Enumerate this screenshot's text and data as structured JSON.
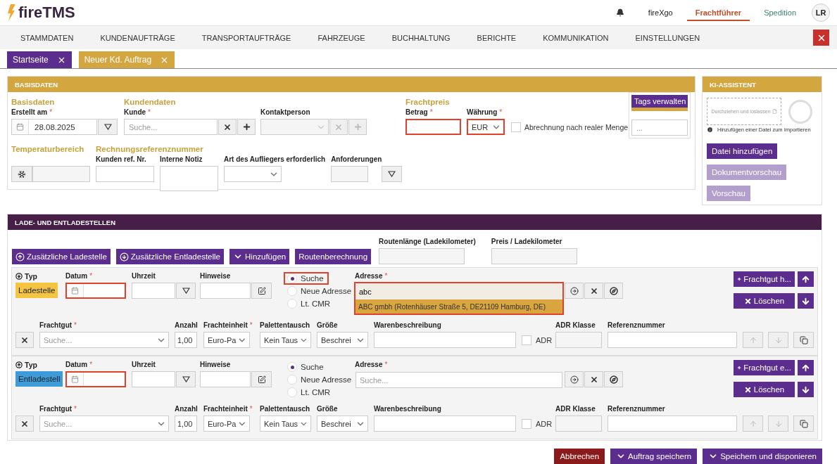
{
  "header": {
    "logo": "fireTMS",
    "links": [
      {
        "label": "fireXgo",
        "selected": false,
        "color": "#222222"
      },
      {
        "label": "Frachtführer",
        "selected": true,
        "color": "#c0502a"
      },
      {
        "label": "Spedition",
        "selected": false,
        "color": "#3d7f6f"
      }
    ],
    "avatar": "LR"
  },
  "menu": [
    "STAMMDATEN",
    "KUNDENAUFTRÄGE",
    "TRANSPORTAUFTRÄGE",
    "FAHRZEUGE",
    "BUCHHALTUNG",
    "BERICHTE",
    "KOMMUNIKATION",
    "EINSTELLUNGEN"
  ],
  "tabs": [
    {
      "label": "Startseite",
      "selected": false
    },
    {
      "label": "Neuer Kd. Auftrag",
      "selected": true
    }
  ],
  "basisdaten": {
    "title": "BASISDATEN",
    "basis": {
      "heading": "Basisdaten",
      "label": "Erstellt am",
      "required_mark": "*",
      "value": "28.08.2025"
    },
    "kunde": {
      "heading": "Kundendaten",
      "label": "Kunde",
      "required_mark": "*",
      "placeholder": "Suche..."
    },
    "kontakt": {
      "label": "Kontaktperson",
      "disabled": true
    },
    "frachtpreis": {
      "heading": "Frachtpreis",
      "betrag": {
        "label": "Betrag",
        "required_mark": "*",
        "error": true
      },
      "waehrung": {
        "label": "Währung",
        "required_mark": "*",
        "value": "EUR",
        "error": true
      },
      "abrechnung": {
        "label": "Abrechnung nach realer Menge",
        "checked": false
      }
    },
    "tags": {
      "button": "Tags verwalten",
      "placeholder": "..."
    },
    "temperatur": {
      "heading": "Temperaturbereich"
    },
    "rechnung": {
      "heading": "Rechnungsreferenznummer",
      "kunden_ref": "Kunden ref. Nr.",
      "notiz": "Interne Notiz"
    },
    "auflieger": {
      "label": "Art des Aufliegers erforderlich"
    },
    "anforderungen": {
      "label": "Anforderungen"
    }
  },
  "ki": {
    "title": "KI-ASSISTENT",
    "dropzone": "Durchziehen und loslassen",
    "hint": "Hinzufügen einer Datei zum Importieren",
    "buttons": [
      {
        "label": "Datei hinzufügen",
        "disabled": false
      },
      {
        "label": "Dokumentvorschau",
        "disabled": true
      },
      {
        "label": "Vorschau",
        "disabled": true
      }
    ]
  },
  "stellen": {
    "title": "LADE- UND ENTLADESTELLEN",
    "actions": [
      {
        "kind": "load",
        "label": "Zusätzliche Ladestelle"
      },
      {
        "kind": "unload",
        "label": "Zusätzliche Entladestelle"
      },
      {
        "kind": "dropdown",
        "label": "Hinzufügen"
      },
      {
        "kind": "plain",
        "label": "Routenberechnung"
      }
    ],
    "route_fields": [
      "Routenlänge (Ladekilometer)",
      "Preis / Ladekilometer"
    ],
    "stops": [
      {
        "kind": "load",
        "typ": "Typ",
        "type": "Ladestelle",
        "color": "#f5c542",
        "datum": {
          "label": "Datum",
          "required_mark": "*",
          "error": true
        },
        "uhrzeit": "Uhrzeit",
        "hinweise": "Hinweise",
        "modes": [
          {
            "label": "Suche",
            "selected": true,
            "error": true
          },
          {
            "label": "Neue Adresse",
            "selected": false,
            "error": false
          },
          {
            "label": "Lt. CMR",
            "selected": false,
            "error": false
          }
        ],
        "adresse": {
          "label": "Adresse",
          "required_mark": "*",
          "value": "abc",
          "error": true,
          "suggestion": "ABC gmbh (Rotenhäuser Straße 5, DE21109 Hamburg, DE)"
        },
        "buttons": [
          "Frachtgut h...",
          "Löschen"
        ],
        "cargo": {
          "frachtgut": {
            "label": "Frachtgut",
            "required_mark": "*",
            "placeholder": "Suche..."
          },
          "anzahl": {
            "label": "Anzahl",
            "value": "1,00"
          },
          "einheit": {
            "label": "Frachteinheit",
            "required_mark": "*",
            "value": "Euro-Pa"
          },
          "tausch": {
            "label": "Palettentausch",
            "value": "Kein Taus"
          },
          "groesse": {
            "label": "Größe",
            "value": "Beschrei"
          },
          "waren": "Warenbeschreibung",
          "adr": {
            "label": "ADR",
            "checked": false
          },
          "adr_klasse": "ADR Klasse",
          "referenz": "Referenznummer"
        }
      },
      {
        "kind": "unload",
        "typ": "Typ",
        "type": "Entladestell",
        "color": "#3d9bd9",
        "datum": {
          "label": "Datum",
          "required_mark": "*",
          "error": true
        },
        "uhrzeit": "Uhrzeit",
        "hinweise": "Hinweise",
        "modes": [
          {
            "label": "Suche",
            "selected": true,
            "error": false
          },
          {
            "label": "Neue Adresse",
            "selected": false,
            "error": false
          },
          {
            "label": "Lt. CMR",
            "selected": false,
            "error": false
          }
        ],
        "adresse": {
          "label": "Adresse",
          "required_mark": "*",
          "placeholder": "Suche...",
          "error": false
        },
        "buttons": [
          "Frachtgut e...",
          "Löschen"
        ],
        "cargo": {
          "frachtgut": {
            "label": "Frachtgut",
            "required_mark": "*",
            "placeholder": "Suche..."
          },
          "anzahl": {
            "label": "Anzahl",
            "value": "1,00"
          },
          "einheit": {
            "label": "Frachteinheit",
            "required_mark": "*",
            "value": "Euro-Pa"
          },
          "tausch": {
            "label": "Palettentausch",
            "value": "Kein Taus"
          },
          "groesse": {
            "label": "Größe",
            "value": "Beschrei"
          },
          "waren": "Warenbeschreibung",
          "adr": {
            "label": "ADR",
            "checked": false
          },
          "adr_klasse": "ADR Klasse",
          "referenz": "Referenznummer"
        }
      }
    ]
  },
  "footer": [
    {
      "kind": "cancel",
      "label": "Abbrechen"
    },
    {
      "kind": "save",
      "label": "Auftrag speichern"
    },
    {
      "kind": "save",
      "label": "Speichern und disponieren"
    }
  ]
}
